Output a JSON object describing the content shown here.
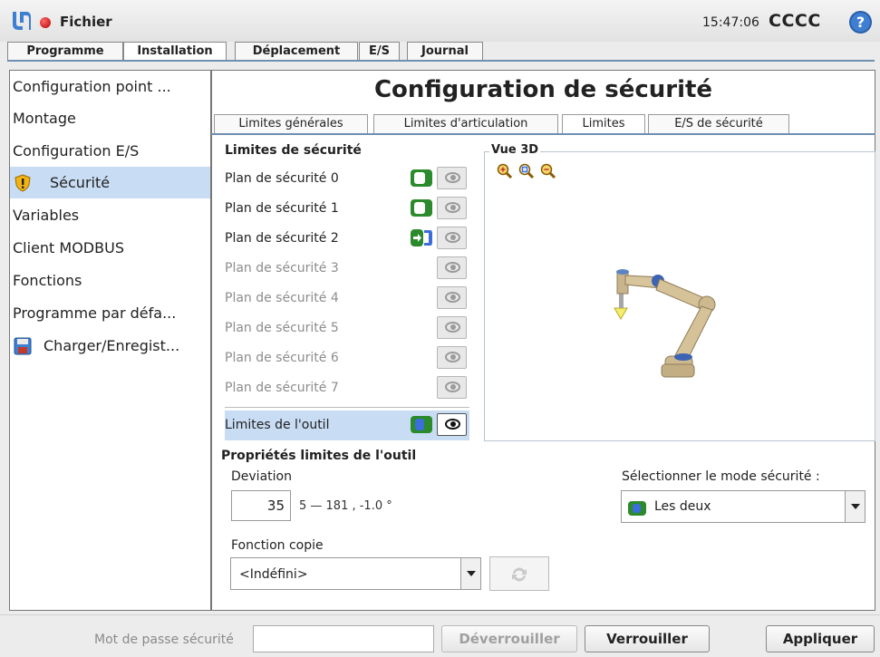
{
  "topbar": {
    "file_label": "Fichier",
    "clock": "15:47:06",
    "robot_name": "CCCC",
    "help_symbol": "?"
  },
  "main_tabs": [
    "Programme",
    "Installation",
    "Déplacement",
    "E/S",
    "Journal"
  ],
  "sidebar": {
    "items": [
      {
        "label": "Configuration point ..."
      },
      {
        "label": "Montage"
      },
      {
        "label": "Configuration E/S"
      },
      {
        "label": "Sécurité",
        "icon": "warning-shield-icon"
      },
      {
        "label": "Variables"
      },
      {
        "label": "Client MODBUS"
      },
      {
        "label": "Fonctions"
      },
      {
        "label": "Programme par défa..."
      },
      {
        "label": "Charger/Enregist...",
        "icon": "save-icon"
      }
    ]
  },
  "page": {
    "title": "Configuration de sécurité",
    "subtabs": [
      "Limites générales",
      "Limites d'articulation",
      "Limites",
      "E/S de sécurité"
    ]
  },
  "limits": {
    "title": "Limites de sécurité",
    "planes": [
      {
        "label": "Plan de sécurité 0"
      },
      {
        "label": "Plan de sécurité 1"
      },
      {
        "label": "Plan de sécurité 2"
      },
      {
        "label": "Plan de sécurité 3"
      },
      {
        "label": "Plan de sécurité 4"
      },
      {
        "label": "Plan de sécurité 5"
      },
      {
        "label": "Plan de sécurité 6"
      },
      {
        "label": "Plan de sécurité 7"
      }
    ],
    "tool_limits_label": "Limites de l'outil"
  },
  "view3d": {
    "title": "Vue 3D"
  },
  "tool_props": {
    "title": "Propriétés limites de l'outil",
    "deviation_label": "Deviation",
    "deviation_value": "35",
    "deviation_range": "5 — 181 , -1.0 °",
    "copy_label": "Fonction copie",
    "copy_value": "<Indéfini>",
    "mode_label": "Sélectionner le mode sécurité :",
    "mode_value": "Les deux"
  },
  "bottom": {
    "password_label": "Mot de passe sécurité",
    "unlock_label": "Déverrouiller",
    "lock_label": "Verrouiller",
    "apply_label": "Appliquer"
  },
  "colors": {
    "accent_blue": "#3c6edb",
    "toggle_green": "#2b8a2b",
    "selection": "#c8dcf4"
  }
}
